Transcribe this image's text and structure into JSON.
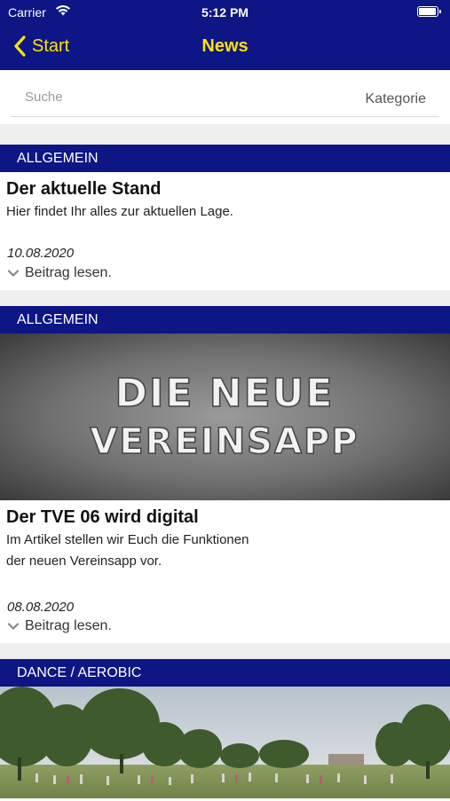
{
  "status_bar": {
    "carrier": "Carrier",
    "time": "5:12 PM"
  },
  "nav": {
    "back_label": "Start",
    "title": "News"
  },
  "search": {
    "placeholder": "Suche",
    "category_label": "Kategorie"
  },
  "colors": {
    "brand_blue": "#0e1585",
    "accent_yellow": "#ffe200"
  },
  "posts": [
    {
      "category": "ALLGEMEIN",
      "title": "Der aktuelle Stand",
      "teaser": "Hier findet Ihr alles zur aktuellen Lage.",
      "date": "10.08.2020",
      "read_more": "Beitrag lesen."
    },
    {
      "category": "ALLGEMEIN",
      "image_text_line1": "DIE NEUE",
      "image_text_line2": "VEREINSAPP",
      "title": "Der TVE 06 wird digital",
      "teaser_line1": "Im Artikel stellen wir Euch die Funktionen",
      "teaser_line2": "der neuen Vereinsapp vor.",
      "date": "08.08.2020",
      "read_more": "Beitrag lesen."
    },
    {
      "category": "DANCE / AEROBIC"
    }
  ]
}
